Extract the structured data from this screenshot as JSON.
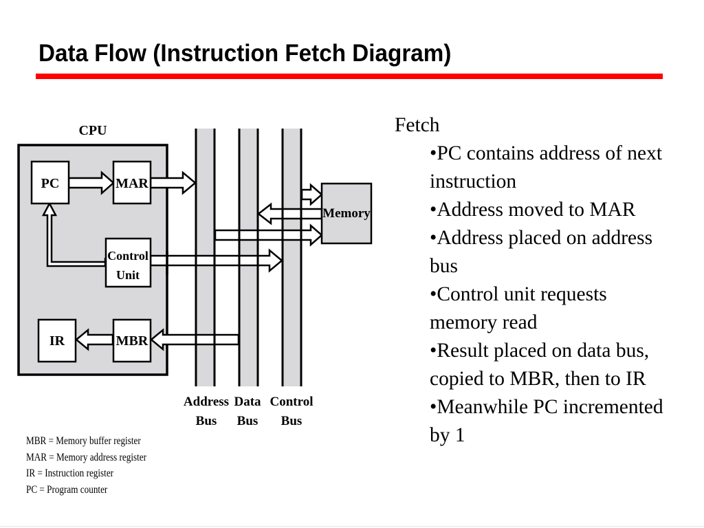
{
  "slide": {
    "title": "Data Flow (Instruction Fetch Diagram)",
    "accent_color": "#ff0000"
  },
  "diagram": {
    "cpu_label": "CPU",
    "registers": {
      "pc": "PC",
      "mar": "MAR",
      "control_unit_line1": "Control",
      "control_unit_line2": "Unit",
      "ir": "IR",
      "mbr": "MBR"
    },
    "memory_label": "Memory",
    "buses": [
      {
        "line1": "Address",
        "line2": "Bus"
      },
      {
        "line1": "Data",
        "line2": "Bus"
      },
      {
        "line1": "Control",
        "line2": "Bus"
      }
    ],
    "colors": {
      "box_fill": "#d9d9db",
      "stroke": "#000000"
    }
  },
  "legend": [
    "MBR = Memory buffer register",
    "MAR = Memory address register",
    "IR = Instruction register",
    "PC = Program counter"
  ],
  "notes": {
    "heading": "Fetch",
    "bullets": [
      "•PC contains address of next instruction",
      "•Address moved to MAR",
      "•Address placed on address bus",
      "•Control unit requests memory read",
      "•Result placed on data bus, copied to MBR, then to IR",
      "•Meanwhile PC incremented by 1"
    ]
  }
}
